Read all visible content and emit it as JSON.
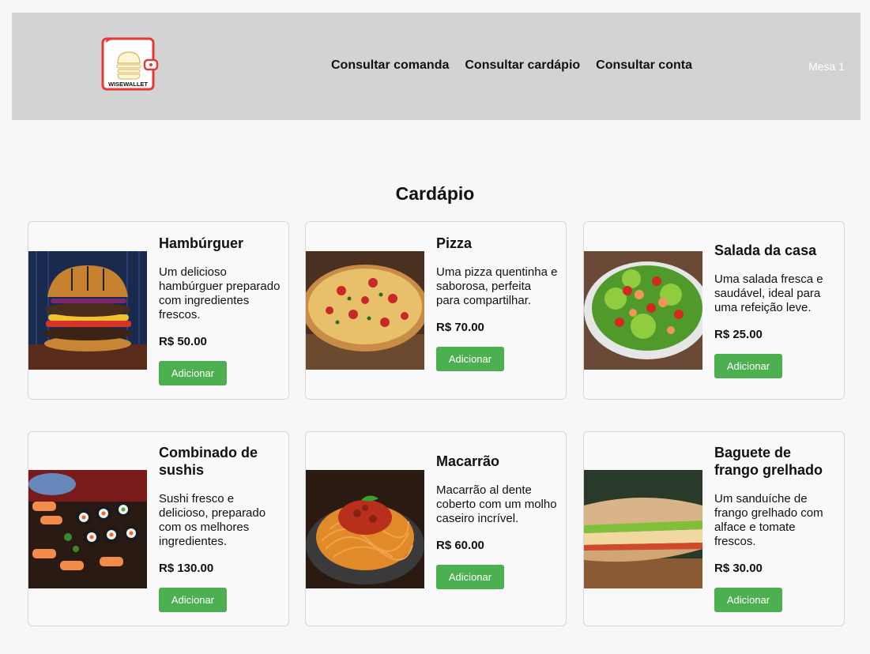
{
  "header": {
    "logo_text": "WISEWALLET",
    "nav": [
      "Consultar comanda",
      "Consultar cardápio",
      "Consultar conta"
    ],
    "table_label": "Mesa 1"
  },
  "page_title": "Cardápio",
  "items": [
    {
      "name": "Hambúrguer",
      "description": "Um delicioso hambúrguer preparado com ingredientes frescos.",
      "price": "R$ 50.00",
      "button": "Adicionar"
    },
    {
      "name": "Pizza",
      "description": "Uma pizza quentinha e saborosa, perfeita para compartilhar.",
      "price": "R$ 70.00",
      "button": "Adicionar"
    },
    {
      "name": "Salada da casa",
      "description": "Uma salada fresca e saudável, ideal para uma refeição leve.",
      "price": "R$ 25.00",
      "button": "Adicionar"
    },
    {
      "name": "Combinado de sushis",
      "description": "Sushi fresco e delicioso, preparado com os melhores ingredientes.",
      "price": "R$ 130.00",
      "button": "Adicionar"
    },
    {
      "name": "Macarrão",
      "description": "Macarrão al dente coberto com um molho caseiro incrível.",
      "price": "R$ 60.00",
      "button": "Adicionar"
    },
    {
      "name": "Baguete de frango grelhado",
      "description": "Um sanduíche de frango grelhado com alface e tomate frescos.",
      "price": "R$ 30.00",
      "button": "Adicionar"
    }
  ],
  "colors": {
    "header_bg": "#d3d3d3",
    "button_bg": "#4caf50",
    "logo_red": "#e53935"
  }
}
